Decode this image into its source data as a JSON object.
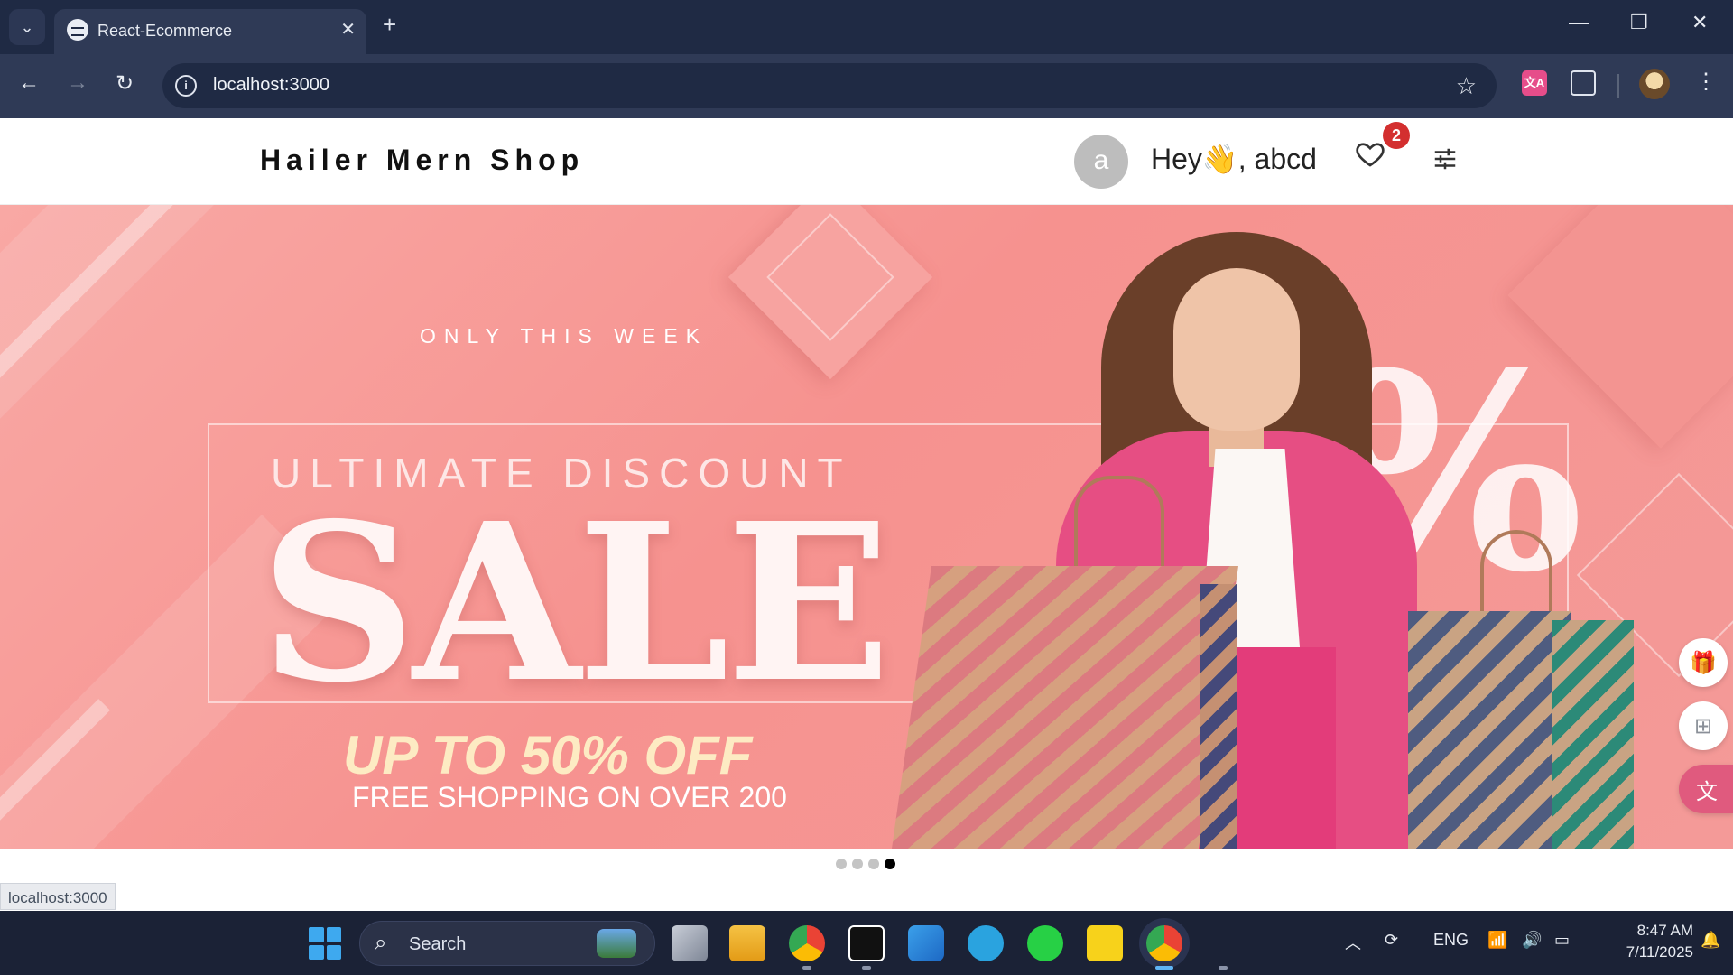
{
  "browser": {
    "tab_title": "React-Ecommerce",
    "url": "localhost:3000",
    "status_url": "localhost:3000",
    "colors": {
      "frame": "#1f2a44",
      "toolbar": "#2f3a56"
    }
  },
  "header": {
    "logo": "Hailer Mern Shop",
    "avatar_letter": "a",
    "greeting": "Hey👋, abcd",
    "wishlist_count": "2"
  },
  "banner": {
    "kicker": "ONLY THIS WEEK",
    "subtitle": "ULTIMATE DISCOUNT",
    "headline": "SALE",
    "offer": "UP TO 50% OFF",
    "note": "FREE SHOPPING ON OVER 200",
    "percent_sign": "%",
    "colors": {
      "background": "#f6928f",
      "offer": "#fdebc3"
    }
  },
  "carousel": {
    "slide_count": 4,
    "active_index": 3
  },
  "side_widgets": [
    "gift-icon",
    "apps-add-icon",
    "translate-icon"
  ],
  "taskbar": {
    "search_placeholder": "Search",
    "language": "ENG",
    "time": "8:47 AM",
    "date": "7/11/2025",
    "apps": [
      "task-view-icon",
      "file-explorer-icon",
      "chrome-profile-icon",
      "notion-icon",
      "vscode-icon",
      "telegram-icon",
      "whatsapp-icon",
      "sticky-notes-icon",
      "chrome-icon"
    ]
  }
}
